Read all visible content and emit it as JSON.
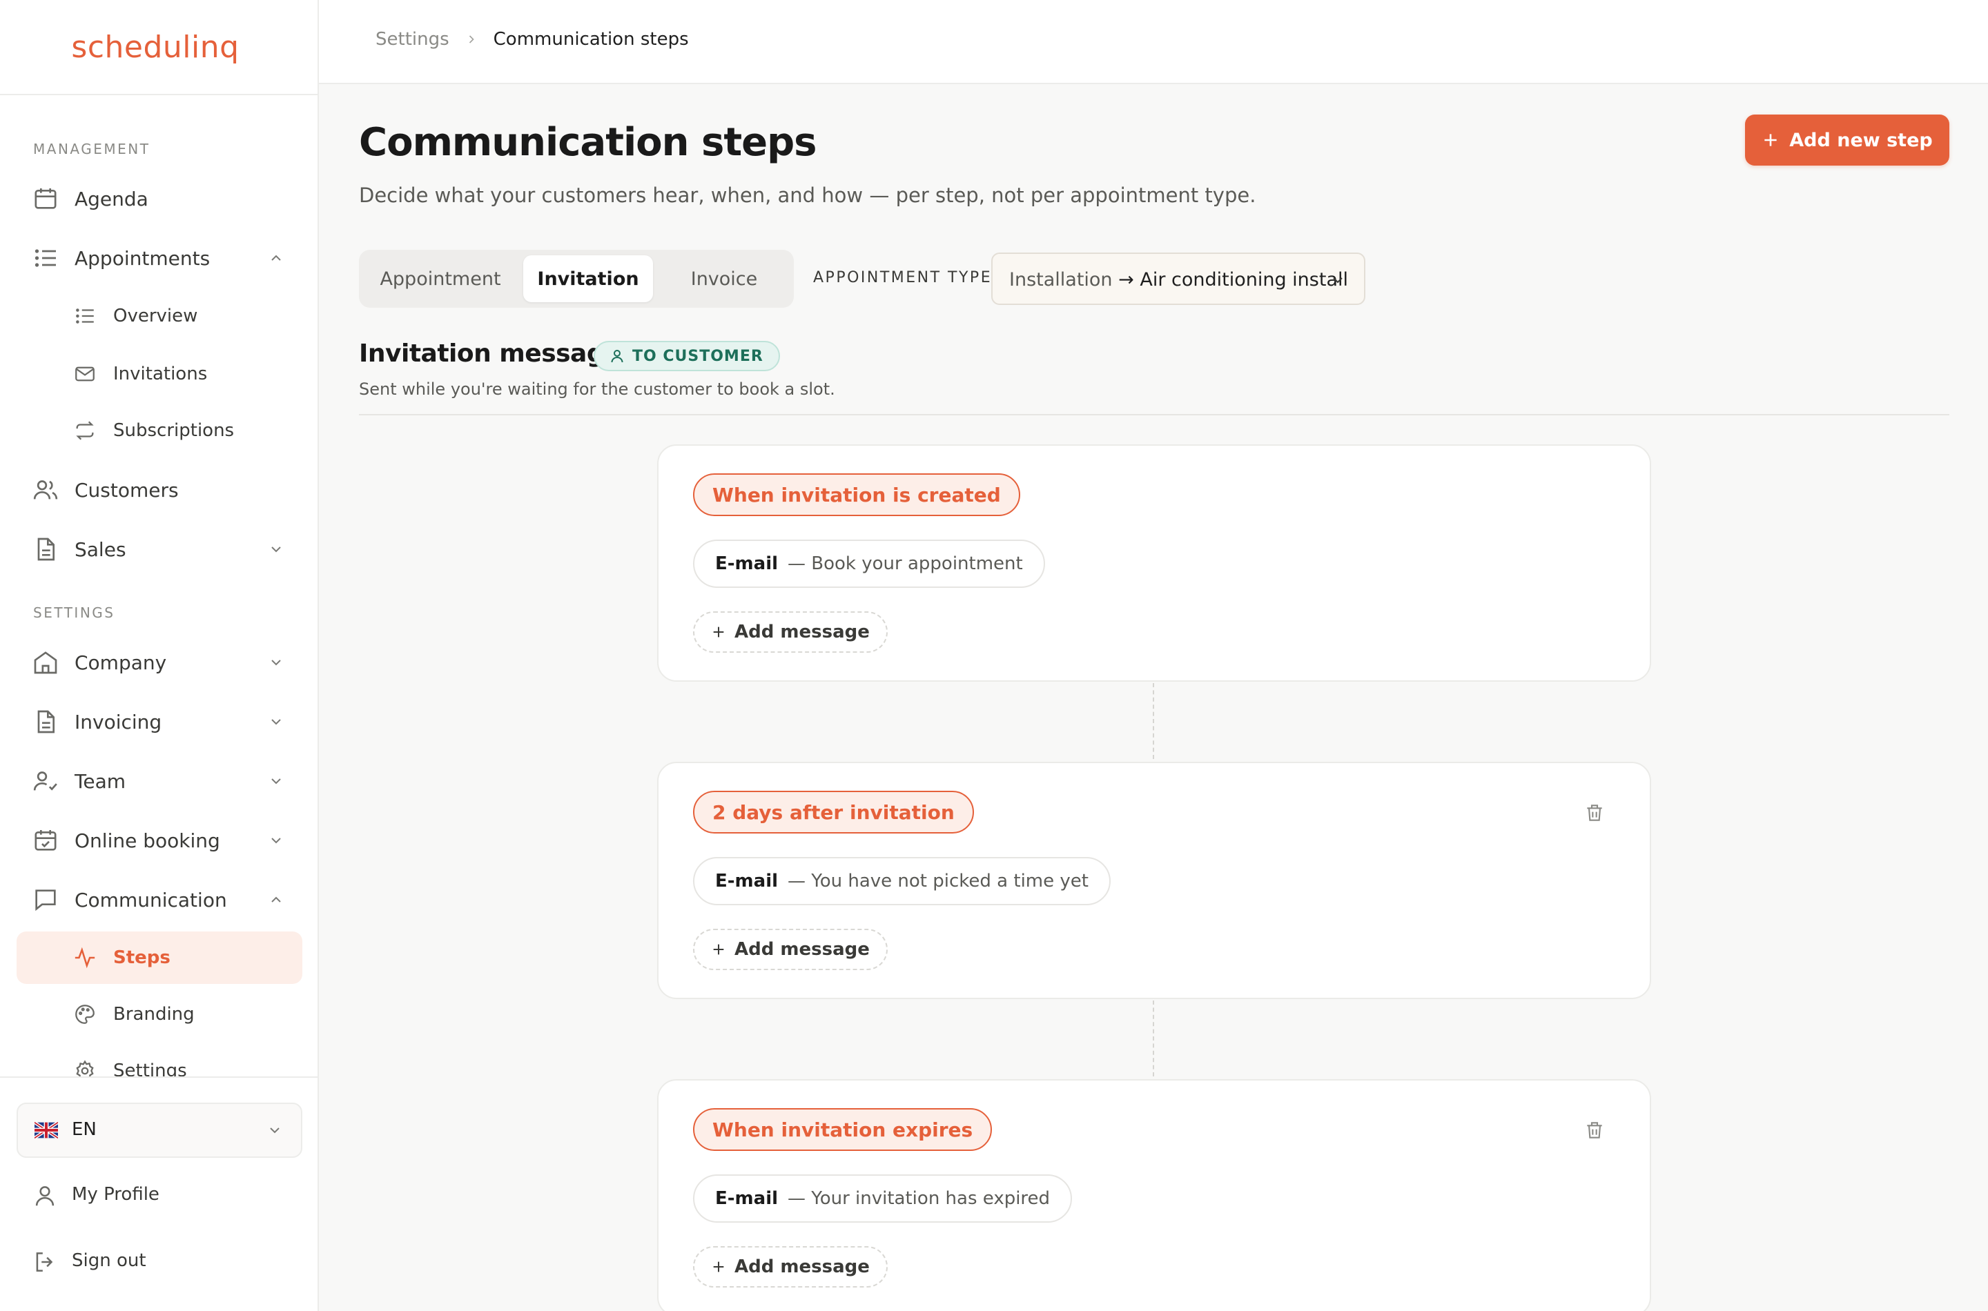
{
  "app": {
    "logo_text": "schedulinq",
    "brand_color": "#e5603a"
  },
  "sidebar": {
    "management_label": "MANAGEMENT",
    "settings_label": "SETTINGS",
    "items": {
      "agenda": "Agenda",
      "appointments": "Appointments",
      "overview": "Overview",
      "invitations": "Invitations",
      "subscriptions": "Subscriptions",
      "customers": "Customers",
      "sales": "Sales",
      "company": "Company",
      "invoicing": "Invoicing",
      "team": "Team",
      "online_booking": "Online booking",
      "communication": "Communication",
      "steps": "Steps",
      "branding": "Branding",
      "settings": "Settings"
    },
    "language": "EN",
    "my_profile": "My Profile",
    "sign_out": "Sign out"
  },
  "breadcrumb": {
    "parent": "Settings",
    "current": "Communication steps"
  },
  "page": {
    "title": "Communication steps",
    "subtitle": "Decide what your customers hear, when, and how — per step, not per appointment type.",
    "add_step_label": "Add new step"
  },
  "tabs": {
    "appointment": "Appointment",
    "invitation": "Invitation",
    "invoice": "Invoice",
    "active": "Invitation"
  },
  "appointment_type": {
    "label": "APPOINTMENT TYPE",
    "category": "Installation",
    "arrow": "→",
    "value": "Air conditioning install"
  },
  "section": {
    "title": "Invitation messages",
    "badge": "TO CUSTOMER",
    "subtitle": "Sent while you're waiting for the customer to book a slot."
  },
  "steps": [
    {
      "trigger": "When invitation is created",
      "channel": "E-mail",
      "message": "— Book your appointment",
      "add_label": "Add message"
    },
    {
      "trigger": "2 days after invitation",
      "channel": "E-mail",
      "message": "— You have not picked a time yet",
      "add_label": "Add message"
    },
    {
      "trigger": "When invitation expires",
      "channel": "E-mail",
      "message": "— Your invitation has expired",
      "add_label": "Add message"
    }
  ]
}
